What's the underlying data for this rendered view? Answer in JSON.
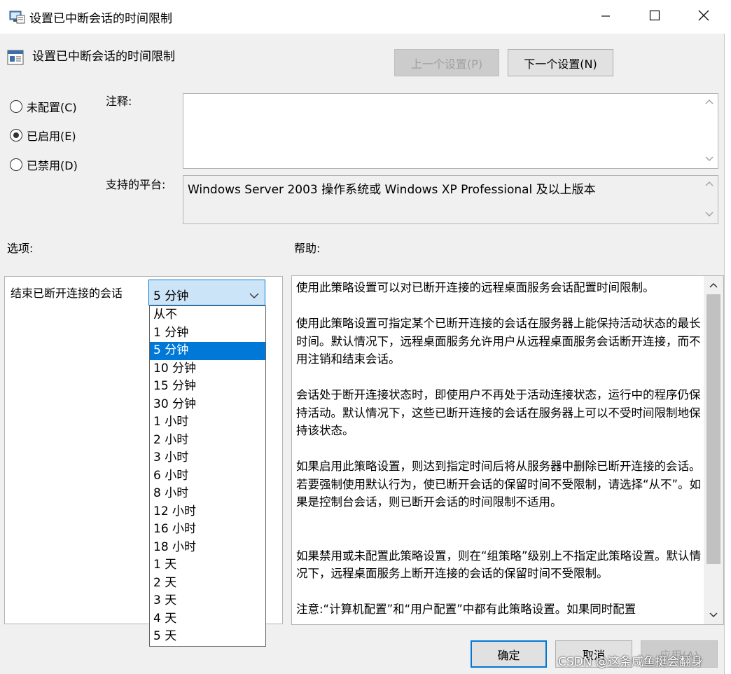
{
  "window": {
    "title": "设置已中断会话的时间限制",
    "icons": [
      "policy-icon",
      "minimize-icon",
      "maximize-icon",
      "close-icon"
    ]
  },
  "header": {
    "title": "设置已中断会话的时间限制",
    "prev_label": "上一个设置(P)",
    "next_label": "下一个设置(N)"
  },
  "state": {
    "options": [
      {
        "label": "未配置(C)",
        "checked": false
      },
      {
        "label": "已启用(E)",
        "checked": true
      },
      {
        "label": "已禁用(D)",
        "checked": false
      }
    ]
  },
  "comment": {
    "label": "注释:",
    "value": ""
  },
  "platform": {
    "label": "支持的平台:",
    "value": "Windows Server 2003 操作系统或 Windows XP Professional 及以上版本"
  },
  "options_section": {
    "label": "选项:",
    "field_label": "结束已断开连接的会话",
    "selected": "5 分钟",
    "items": [
      "从不",
      "1 分钟",
      "5 分钟",
      "10 分钟",
      "15 分钟",
      "30 分钟",
      "1 小时",
      "2 小时",
      "3 小时",
      "6 小时",
      "8 小时",
      "12 小时",
      "16 小时",
      "18 小时",
      "1 天",
      "2 天",
      "3 天",
      "4 天",
      "5 天"
    ]
  },
  "help": {
    "label": "帮助:",
    "paragraphs": [
      "使用此策略设置可以对已断开连接的远程桌面服务会话配置时间限制。",
      "使用此策略设置可指定某个已断开连接的会话在服务器上能保持活动状态的最长时间。默认情况下，远程桌面服务允许用户从远程桌面服务会话断开连接，而不用注销和结束会话。",
      "会话处于断开连接状态时，即使用户不再处于活动连接状态，运行中的程序仍保持活动。默认情况下，这些已断开连接的会话在服务器上可以不受时间限制地保持该状态。",
      "如果启用此策略设置，则达到指定时间后将从服务器中删除已断开连接的会话。若要强制使用默认行为，使已断开会话的保留时间不受限制，请选择“从不”。如果是控制台会话，则已断开会话的时间限制不适用。",
      "如果禁用或未配置此策略设置，则在“组策略”级别上不指定此策略设置。默认情况下，远程桌面服务上断开连接的会话的保留时间不受限制。",
      "注意:“计算机配置”和“用户配置”中都有此策略设置。如果同时配置"
    ]
  },
  "footer": {
    "ok_label": "确定",
    "cancel_label": "取消",
    "apply_label": "应用(A)",
    "watermark": "CSDN @这条咸鱼挺会翻身"
  },
  "colors": {
    "accent": "#0078d7",
    "combo_bg": "#cce4f7"
  }
}
